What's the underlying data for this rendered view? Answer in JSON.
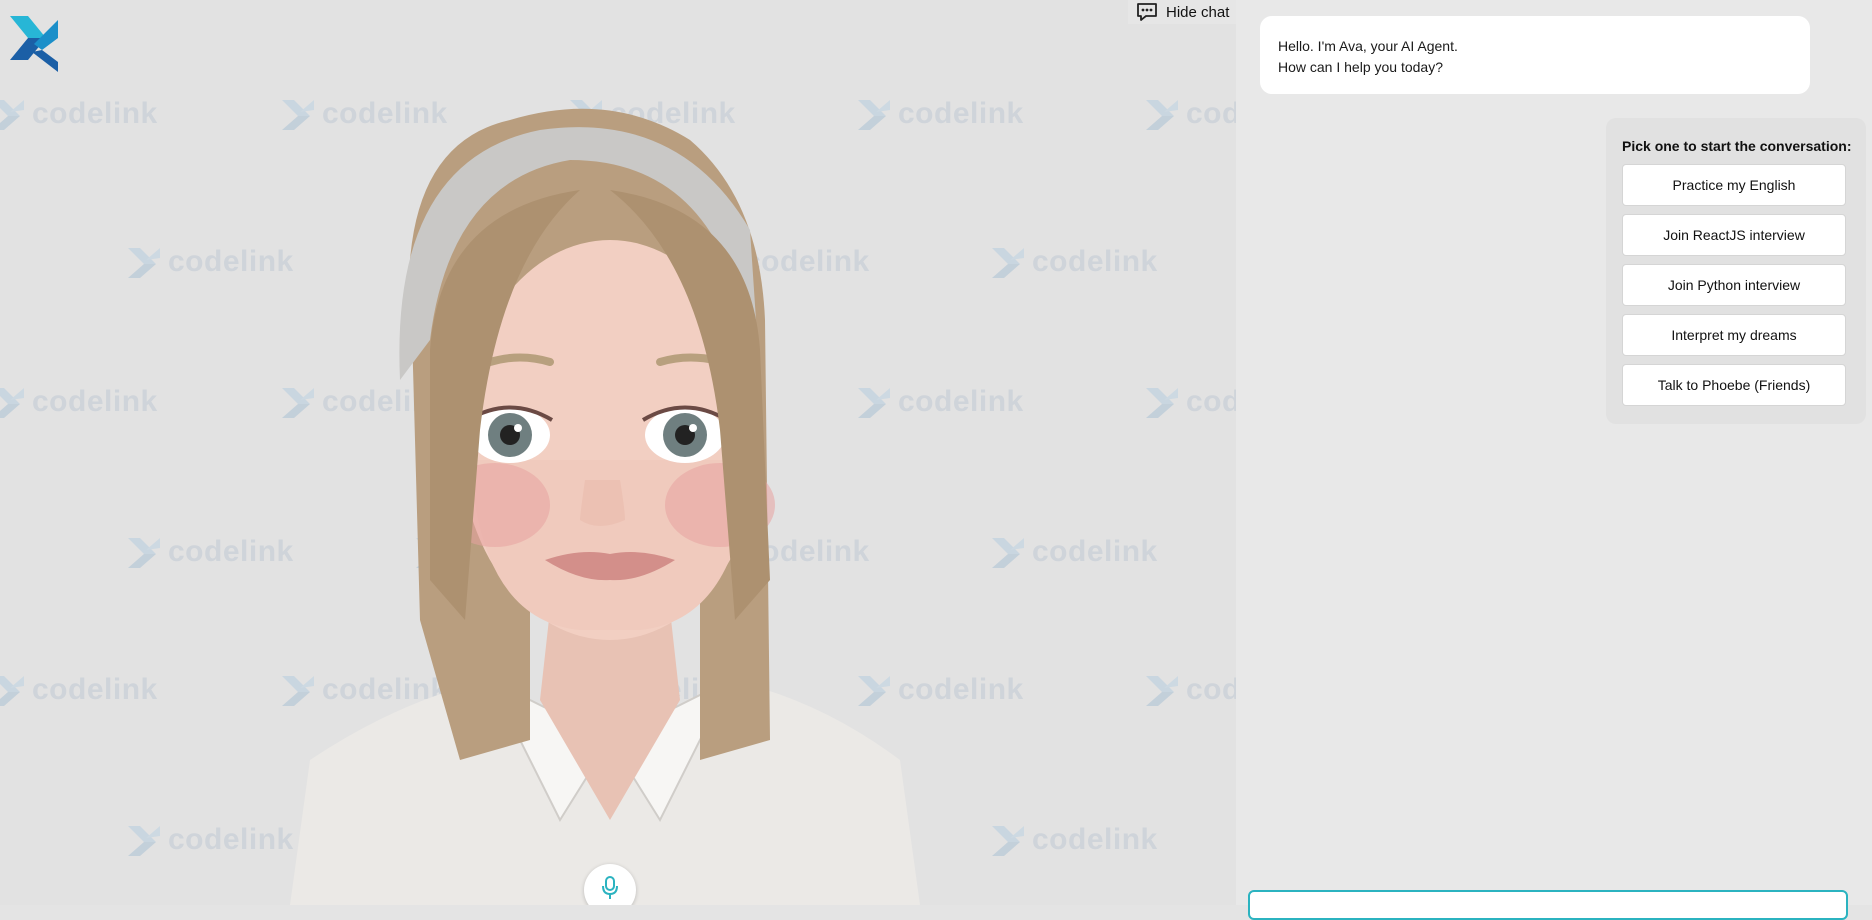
{
  "brand": {
    "name": "codelink",
    "accent": "#2bb3c0",
    "logo_dark": "#1b5fa6",
    "logo_light": "#27b6d6"
  },
  "watermark": {
    "text": "codelink"
  },
  "header": {
    "hide_chat_label": "Hide chat",
    "hide_chat_icon": "chat-bubble-dots-icon"
  },
  "mic": {
    "icon": "microphone-icon"
  },
  "chat": {
    "greeting_line1": "Hello. I'm Ava, your AI Agent.",
    "greeting_line2": "How can I help you today?",
    "starter_title": "Pick one to start the conversation:",
    "options": [
      {
        "label": "Practice my English"
      },
      {
        "label": "Join ReactJS interview"
      },
      {
        "label": "Join Python interview"
      },
      {
        "label": "Interpret my dreams"
      },
      {
        "label": "Talk to Phoebe (Friends)"
      }
    ],
    "input_placeholder": ""
  }
}
